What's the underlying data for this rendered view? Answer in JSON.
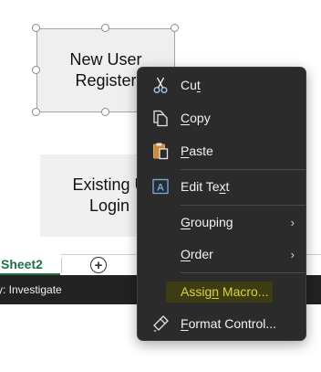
{
  "shapes": {
    "new_user": "New User\nRegister",
    "existing_user": "Existing U\nLogin"
  },
  "tabs": {
    "sheet_name": "Sheet2",
    "add_icon": "plus-circle-icon"
  },
  "status": {
    "text": "y: Investigate"
  },
  "menu": {
    "cut": {
      "pre": "Cu",
      "acc": "t",
      "post": ""
    },
    "copy": {
      "pre": "",
      "acc": "C",
      "post": "opy"
    },
    "paste": {
      "pre": "",
      "acc": "P",
      "post": "aste"
    },
    "edit_text": {
      "pre": "Edit Te",
      "acc": "x",
      "post": "t"
    },
    "grouping": {
      "pre": "",
      "acc": "G",
      "post": "rouping"
    },
    "order": {
      "pre": "",
      "acc": "O",
      "post": "rder"
    },
    "assign_macro": {
      "pre": "Assig",
      "acc": "n",
      "post": " Macro..."
    },
    "format_control": {
      "pre": "",
      "acc": "F",
      "post": "ormat Control..."
    },
    "submenu_arrow": "›"
  },
  "colors": {
    "menu_bg": "#2b2b2b",
    "highlight_text": "#e0d23a",
    "sheet_tab": "#1e7145",
    "statusbar_bg": "#222222"
  }
}
